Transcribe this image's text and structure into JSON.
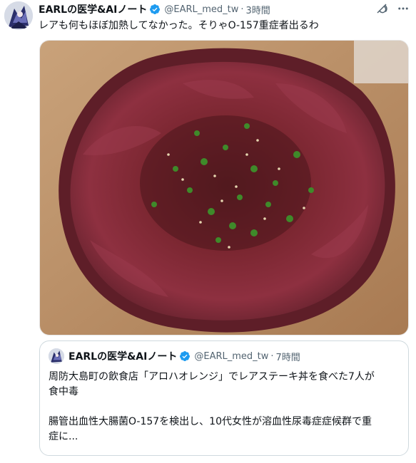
{
  "tweet": {
    "display_name": "EARLの医学&AIノート",
    "handle": "@EARL_med_tw",
    "separator": "·",
    "time": "3時間",
    "text": "レアも何もほぼ加熱してなかった。そりゃO-157重症者出るわ",
    "avatar_icon": "cartoon-character-avatar-icon",
    "verified_icon": "verified-badge-icon",
    "grok_icon": "grok-icon",
    "more_icon": "more-options-icon",
    "media_description_icon": "photo-icon"
  },
  "quote": {
    "display_name": "EARLの医学&AIノート",
    "handle": "@EARL_med_tw",
    "separator": "·",
    "time": "7時間",
    "lines": [
      "周防大島町の飲食店「アロハオレンジ」でレアステーキ丼を食べた7人が",
      "食中毒",
      "",
      "腸管出血性大腸菌O-157を検出し、10代女性が溶血性尿毒症症候群で重",
      "症に..."
    ]
  },
  "colors": {
    "verified": "#1d9bf0",
    "secondary_text": "#536471",
    "border": "#cfd9de"
  }
}
